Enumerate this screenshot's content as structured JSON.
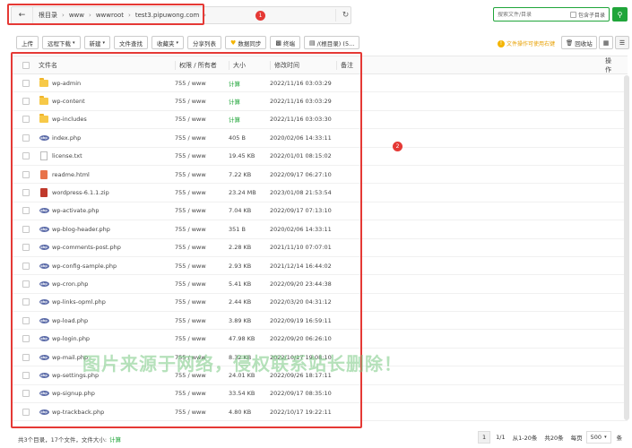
{
  "path": {
    "back_icon": "arrow-left-icon",
    "crumbs": [
      "根目录",
      "www",
      "wwwroot",
      "test3.pipuwong.com"
    ],
    "refresh_icon": "refresh-icon"
  },
  "callouts": [
    "1",
    "2"
  ],
  "search": {
    "placeholder": "搜索文件/目录",
    "subdir_label": "包含子目录",
    "button_icon": "search-icon"
  },
  "toolbar": {
    "upload": "上传",
    "remote_download": "远程下载",
    "new": "新建",
    "file_search": "文件查找",
    "favorites": "收藏夹",
    "share_list": "分享列表",
    "data_sync": "数据同步",
    "terminal": "终端",
    "root_dir": "/(根目录) (5...",
    "tip": "文件操作可使用右键",
    "recycle": "回收站"
  },
  "table": {
    "headers": {
      "name": "文件名",
      "perm": "权限 / 所有者",
      "size": "大小",
      "time": "修改时间",
      "note": "备注",
      "op": "操作"
    },
    "rows": [
      {
        "name": "wp-admin",
        "type": "folder",
        "perm": "755 / www",
        "size": "计算",
        "time": "2022/11/16 03:03:29"
      },
      {
        "name": "wp-content",
        "type": "folder",
        "perm": "755 / www",
        "size": "计算",
        "time": "2022/11/16 03:03:29"
      },
      {
        "name": "wp-includes",
        "type": "folder",
        "perm": "755 / www",
        "size": "计算",
        "time": "2022/11/16 03:03:30"
      },
      {
        "name": "index.php",
        "type": "php",
        "perm": "755 / www",
        "size": "405 B",
        "time": "2020/02/06 14:33:11"
      },
      {
        "name": "license.txt",
        "type": "txt",
        "perm": "755 / www",
        "size": "19.45 KB",
        "time": "2022/01/01 08:15:02"
      },
      {
        "name": "readme.html",
        "type": "html",
        "perm": "755 / www",
        "size": "7.22 KB",
        "time": "2022/09/17 06:27:10"
      },
      {
        "name": "wordpress-6.1.1.zip",
        "type": "zip",
        "perm": "755 / www",
        "size": "23.24 MB",
        "time": "2023/01/08 21:53:54"
      },
      {
        "name": "wp-activate.php",
        "type": "php",
        "perm": "755 / www",
        "size": "7.04 KB",
        "time": "2022/09/17 07:13:10"
      },
      {
        "name": "wp-blog-header.php",
        "type": "php",
        "perm": "755 / www",
        "size": "351 B",
        "time": "2020/02/06 14:33:11"
      },
      {
        "name": "wp-comments-post.php",
        "type": "php",
        "perm": "755 / www",
        "size": "2.28 KB",
        "time": "2021/11/10 07:07:01"
      },
      {
        "name": "wp-config-sample.php",
        "type": "php",
        "perm": "755 / www",
        "size": "2.93 KB",
        "time": "2021/12/14 16:44:02"
      },
      {
        "name": "wp-cron.php",
        "type": "php",
        "perm": "755 / www",
        "size": "5.41 KB",
        "time": "2022/09/20 23:44:38"
      },
      {
        "name": "wp-links-opml.php",
        "type": "php",
        "perm": "755 / www",
        "size": "2.44 KB",
        "time": "2022/03/20 04:31:12"
      },
      {
        "name": "wp-load.php",
        "type": "php",
        "perm": "755 / www",
        "size": "3.89 KB",
        "time": "2022/09/19 16:59:11"
      },
      {
        "name": "wp-login.php",
        "type": "php",
        "perm": "755 / www",
        "size": "47.98 KB",
        "time": "2022/09/20 06:26:10"
      },
      {
        "name": "wp-mail.php",
        "type": "php",
        "perm": "755 / www",
        "size": "8.32 KB",
        "time": "2022/10/17 19:08:10"
      },
      {
        "name": "wp-settings.php",
        "type": "php",
        "perm": "755 / www",
        "size": "24.01 KB",
        "time": "2022/09/26 18:17:11"
      },
      {
        "name": "wp-signup.php",
        "type": "php",
        "perm": "755 / www",
        "size": "33.54 KB",
        "time": "2022/09/17 08:35:10"
      },
      {
        "name": "wp-trackback.php",
        "type": "php",
        "perm": "755 / www",
        "size": "4.80 KB",
        "time": "2022/10/17 19:22:11"
      }
    ]
  },
  "watermark": "图片来源于网络，侵权联系站长删除！",
  "footer": {
    "summary": "共3个目录，17个文件，文件大小:",
    "size_link": "计算",
    "current_page": "1",
    "page_info": "1/1",
    "range": "从1-20条",
    "total": "共20条",
    "per_page_label": "每页",
    "per_page_value": "500",
    "per_page_unit": "条"
  },
  "colors": {
    "accent": "#20a53a",
    "callout": "#e53935",
    "folder": "#f7c948"
  }
}
